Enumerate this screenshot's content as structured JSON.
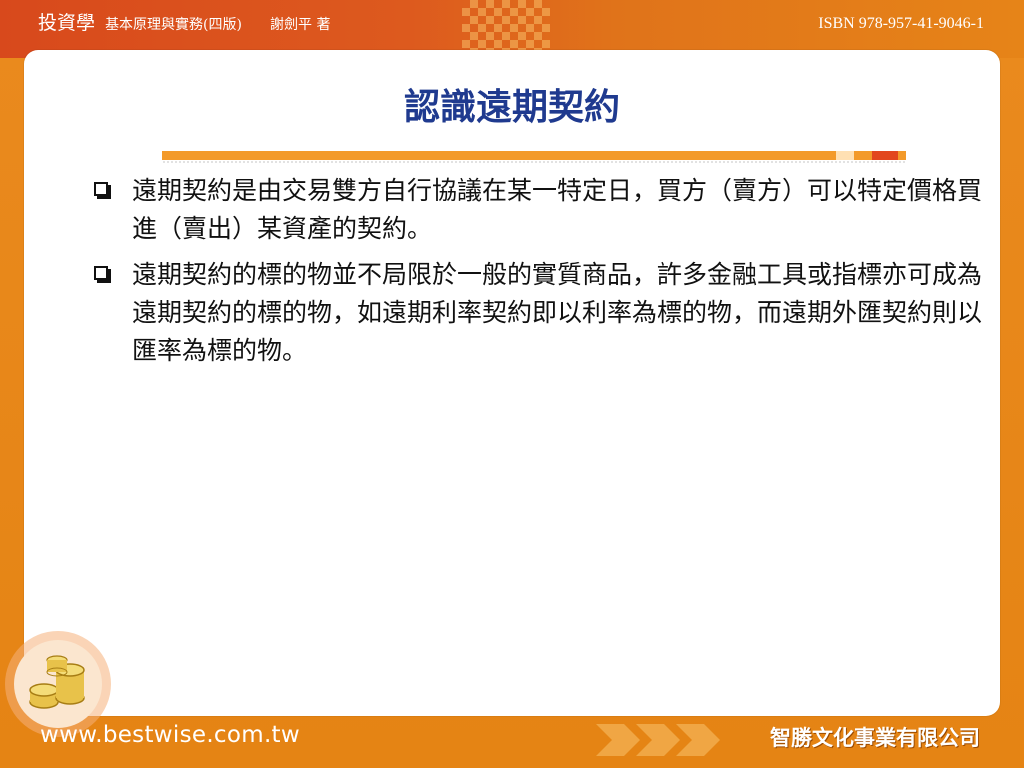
{
  "header": {
    "book_title": "投資學",
    "book_subtitle": "基本原理與實務(四版)",
    "author": "謝劍平 著",
    "isbn": "ISBN 978-957-41-9046-1"
  },
  "slide": {
    "title": "認識遠期契約",
    "bullets": [
      "遠期契約是由交易雙方自行協議在某一特定日，買方（賣方）可以特定價格買進（賣出）某資產的契約。",
      "遠期契約的標的物並不局限於一般的實質商品，許多金融工具或指標亦可成為遠期契約的標的物，如遠期利率契約即以利率為標的物，而遠期外匯契約則以匯率為標的物。"
    ]
  },
  "footer": {
    "website": "www.bestwise.com.tw",
    "company": "智勝文化事業有限公司"
  },
  "colors": {
    "title": "#1f3a8f",
    "frame_orange": "#e68418",
    "band_red": "#d8491c"
  },
  "icons": [
    "checkbox-bullet-icon",
    "coin-stack-logo-icon",
    "arrow-chevrons-icon"
  ]
}
